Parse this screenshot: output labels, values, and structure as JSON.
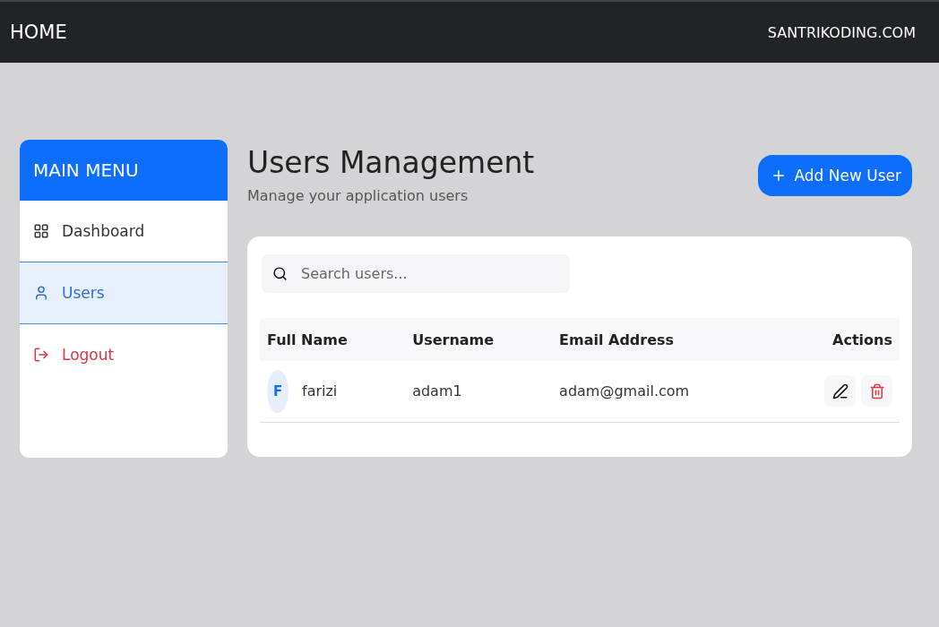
{
  "navbar": {
    "brand": "HOME",
    "link": "SANTRIKODING.COM"
  },
  "sidebar": {
    "title": "MAIN MENU",
    "items": [
      {
        "label": "Dashboard",
        "kind": "normal",
        "selected": false
      },
      {
        "label": "Users",
        "kind": "normal",
        "selected": true
      },
      {
        "label": "Logout",
        "kind": "danger",
        "selected": false
      }
    ]
  },
  "page": {
    "title": "Users Management",
    "subtitle": "Manage your application users",
    "add_button": "Add New User"
  },
  "search": {
    "placeholder": "Search users..."
  },
  "table": {
    "columns": [
      "Full Name",
      "Username",
      "Email Address",
      "Actions"
    ],
    "rows": [
      {
        "initial": "F",
        "full_name": "farizi",
        "username": "adam1",
        "email": "adam@gmail.com"
      }
    ]
  }
}
